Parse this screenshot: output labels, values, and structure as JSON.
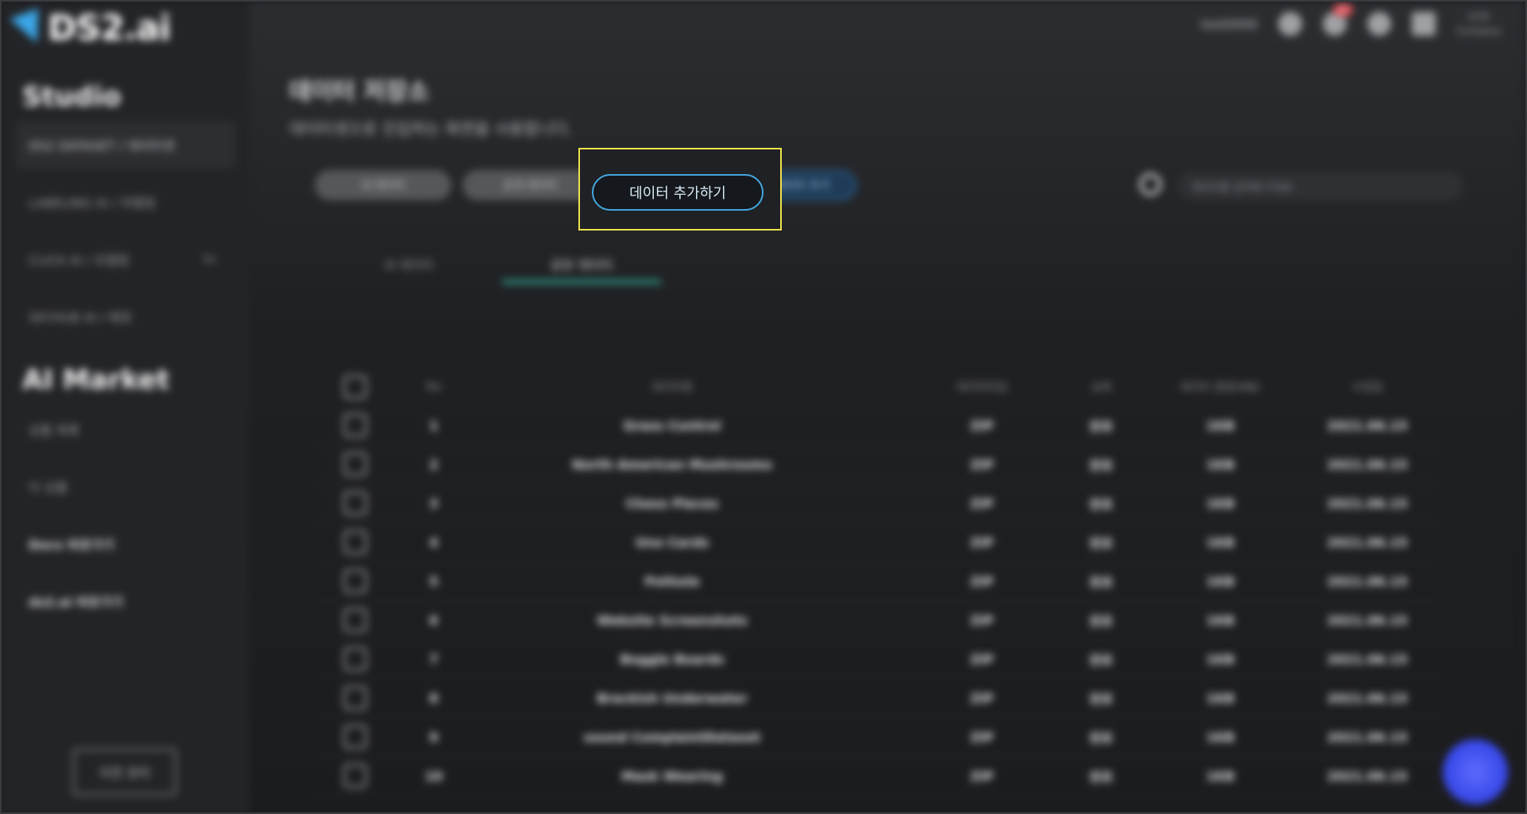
{
  "logo": {
    "text": "DS2.ai"
  },
  "sidebar": {
    "studio_title": "Studio",
    "studio_items": [
      {
        "label": "DS2 DATASET / 데이터셋"
      },
      {
        "label": "LABELING AI / 라벨링"
      },
      {
        "label": "CLICK AI / 모델링",
        "badge": "ko"
      },
      {
        "label": "SKYHUB AI / 배포"
      }
    ],
    "market_title": "AI Market",
    "market_items": [
      {
        "label": "상품 목록"
      },
      {
        "label": "이 상품"
      },
      {
        "label": "Docs 바로가기"
      },
      {
        "label": "ds2.ai 바로가기"
      }
    ],
    "bottom_button": "이전 관리"
  },
  "topbar": {
    "user": "test0000",
    "notif_count": "99",
    "small_top": "0/30",
    "small_bottom": "Company"
  },
  "page": {
    "title": "데이터 저장소",
    "subtitle": "데이터셋으로 진입하는 화면을 사용합니다."
  },
  "chips": [
    {
      "label": "내 데이터"
    },
    {
      "label": "공개 데이터"
    },
    {
      "label": "데이터 추가"
    }
  ],
  "search": {
    "placeholder": "데이터를 검색해 주세요"
  },
  "tabs": [
    {
      "label": "내 데이터"
    },
    {
      "label": "공유 데이터"
    }
  ],
  "table": {
    "headers": [
      "No",
      "데이터명",
      "데이터타입",
      "상태",
      "데이터 용량(MB)",
      "수정일"
    ],
    "rows": [
      {
        "no": "1",
        "name": "Grass Control",
        "type": "ZIP",
        "status": "완료",
        "size": "1KB",
        "date": "2021.06.15"
      },
      {
        "no": "2",
        "name": "North American Mushrooms",
        "type": "ZIP",
        "status": "완료",
        "size": "1KB",
        "date": "2021.06.15"
      },
      {
        "no": "3",
        "name": "Chess Pieces",
        "type": "ZIP",
        "status": "완료",
        "size": "1KB",
        "date": "2021.06.15"
      },
      {
        "no": "4",
        "name": "Uno Cards",
        "type": "ZIP",
        "status": "완료",
        "size": "1KB",
        "date": "2021.06.15"
      },
      {
        "no": "5",
        "name": "Pothole",
        "type": "ZIP",
        "status": "완료",
        "size": "1KB",
        "date": "2021.06.15"
      },
      {
        "no": "6",
        "name": "Website Screenshots",
        "type": "ZIP",
        "status": "완료",
        "size": "1KB",
        "date": "2021.06.15"
      },
      {
        "no": "7",
        "name": "Boggle Boards",
        "type": "ZIP",
        "status": "완료",
        "size": "1KB",
        "date": "2021.06.15"
      },
      {
        "no": "8",
        "name": "Brackish Underwater",
        "type": "ZIP",
        "status": "완료",
        "size": "1KB",
        "date": "2021.06.15"
      },
      {
        "no": "9",
        "name": "sound ComplaintDataset",
        "type": "ZIP",
        "status": "완료",
        "size": "1KB",
        "date": "2021.06.15"
      },
      {
        "no": "10",
        "name": "Mask Wearing",
        "type": "ZIP",
        "status": "완료",
        "size": "1KB",
        "date": "2021.06.15"
      }
    ]
  },
  "focus": {
    "add_data_label": "데이터 추가하기"
  }
}
